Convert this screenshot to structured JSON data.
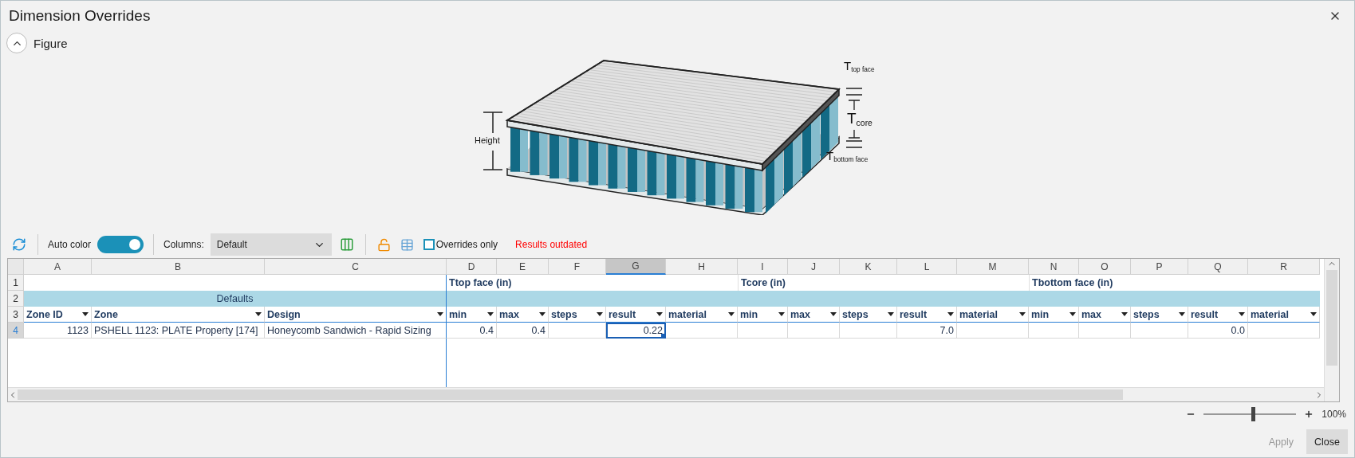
{
  "window": {
    "title": "Dimension Overrides"
  },
  "figure": {
    "label": "Figure",
    "expanded": true,
    "labels": {
      "height": "Height",
      "top_face": "T$_{top face}$",
      "core": "T$_{core}$",
      "bottom_face": "T$_{bottom face}$"
    }
  },
  "toolbar": {
    "auto_color": {
      "label": "Auto color",
      "on": true
    },
    "columns": {
      "label": "Columns:",
      "value": "Default"
    },
    "overrides_only": {
      "label": "Overrides only",
      "checked": false
    },
    "status": "Results outdated"
  },
  "grid": {
    "column_letters": [
      {
        "letter": "A",
        "selected": false
      },
      {
        "letter": "B",
        "selected": false
      },
      {
        "letter": "C",
        "selected": false
      },
      {
        "letter": "D",
        "selected": false
      },
      {
        "letter": "E",
        "selected": false
      },
      {
        "letter": "F",
        "selected": false
      },
      {
        "letter": "G",
        "selected": true
      },
      {
        "letter": "H",
        "selected": false
      },
      {
        "letter": "I",
        "selected": false
      },
      {
        "letter": "J",
        "selected": false
      },
      {
        "letter": "K",
        "selected": false
      },
      {
        "letter": "L",
        "selected": false
      },
      {
        "letter": "M",
        "selected": false
      },
      {
        "letter": "N",
        "selected": false
      },
      {
        "letter": "O",
        "selected": false
      },
      {
        "letter": "P",
        "selected": false
      },
      {
        "letter": "Q",
        "selected": false
      },
      {
        "letter": "R",
        "selected": false
      }
    ],
    "row_numbers": [
      {
        "label": "1",
        "selected": false
      },
      {
        "label": "2",
        "selected": false
      },
      {
        "label": "3",
        "selected": false
      },
      {
        "label": "4",
        "selected": true
      }
    ],
    "defaults_label": "Defaults",
    "fixed_columns": [
      "Zone ID",
      "Zone",
      "Design"
    ],
    "groups": [
      {
        "label": "Ttop face (in)",
        "columns": [
          "min",
          "max",
          "steps",
          "result",
          "material"
        ]
      },
      {
        "label": "Tcore (in)",
        "columns": [
          "min",
          "max",
          "steps",
          "result",
          "material"
        ]
      },
      {
        "label": "Tbottom face (in)",
        "columns": [
          "min",
          "max",
          "steps",
          "result",
          "material"
        ]
      }
    ],
    "rows": [
      {
        "zone_id": "1123",
        "zone": "PSHELL 1123: PLATE Property [174]",
        "design": "Honeycomb Sandwich - Rapid Sizing",
        "groups": [
          {
            "min": "0.4",
            "max": "0.4",
            "result": "0.22"
          },
          {
            "result": "7.0"
          },
          {
            "result": "0.0"
          }
        ]
      }
    ]
  },
  "zoom": {
    "level": 0.53,
    "reading": "100%"
  },
  "buttons": [
    {
      "label": "Apply",
      "disabled": true
    },
    {
      "label": "Close",
      "disabled": false
    }
  ]
}
